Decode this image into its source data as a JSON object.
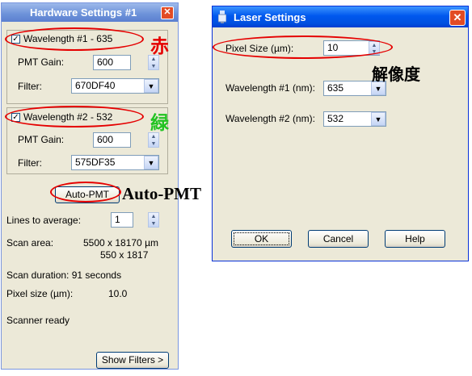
{
  "hardware_panel": {
    "title": "Hardware Settings #1",
    "close_glyph": "✕",
    "wl1": {
      "label": "Wavelength #1 - 635",
      "checked": true
    },
    "pmt1": {
      "label": "PMT Gain:",
      "value": "600"
    },
    "filter1": {
      "label": "Filter:",
      "value": "670DF40"
    },
    "wl2": {
      "label": "Wavelength #2 - 532",
      "checked": true
    },
    "pmt2": {
      "label": "PMT Gain:",
      "value": "600"
    },
    "filter2": {
      "label": "Filter:",
      "value": "575DF35"
    },
    "auto_pmt_button": "Auto-PMT",
    "lines_avg": {
      "label": "Lines to average:",
      "value": "1"
    },
    "scan_area": {
      "label": "Scan area:",
      "line1": "5500 x 18170 µm",
      "line2": "550 x 1817"
    },
    "scan_duration": "Scan duration: 91 seconds",
    "pixel_size": {
      "label": "Pixel size (µm):",
      "value": "10.0"
    },
    "status": "Scanner ready",
    "show_filters_button": "Show Filters >"
  },
  "laser_dialog": {
    "title": "Laser Settings",
    "close_glyph": "✕",
    "pixel_size": {
      "label": "Pixel Size (µm):",
      "value": "10"
    },
    "wavelength1": {
      "label": "Wavelength #1 (nm):",
      "value": "635"
    },
    "wavelength2": {
      "label": "Wavelength #2 (nm):",
      "value": "532"
    },
    "ok_button": "OK",
    "cancel_button": "Cancel",
    "help_button": "Help"
  },
  "annotations": {
    "red_label": "赤",
    "green_label": "緑",
    "auto_pmt_label": "Auto-PMT",
    "resolution_label": "解像度"
  },
  "colors": {
    "annotation_red": "#e50000",
    "annotation_green": "#22c322",
    "title_blue": "#0058ee"
  }
}
